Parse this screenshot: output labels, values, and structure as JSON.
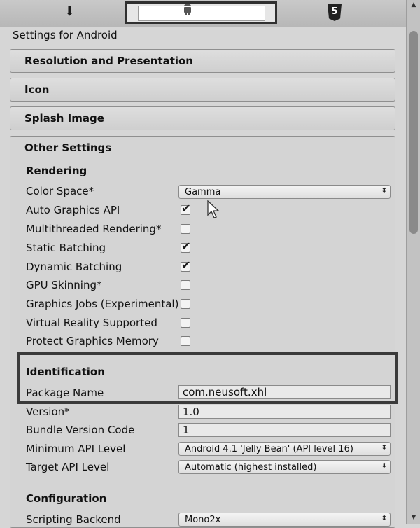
{
  "tabs": [
    {
      "name": "standalone",
      "icon": "download-arrow-icon",
      "selected": false
    },
    {
      "name": "android",
      "icon": "android-icon",
      "selected": true
    },
    {
      "name": "webgl",
      "icon": "html5-icon",
      "label": "5",
      "selected": false
    }
  ],
  "header": {
    "title": "Settings for Android"
  },
  "sections": {
    "resolution": "Resolution and Presentation",
    "icon": "Icon",
    "splash": "Splash Image",
    "other": "Other Settings"
  },
  "rendering": {
    "heading": "Rendering",
    "color_space": {
      "label": "Color Space*",
      "value": "Gamma"
    },
    "auto_graphics": {
      "label": "Auto Graphics API",
      "checked": true
    },
    "multithreaded": {
      "label": "Multithreaded Rendering*",
      "checked": false
    },
    "static_batching": {
      "label": "Static Batching",
      "checked": true
    },
    "dynamic_batching": {
      "label": "Dynamic Batching",
      "checked": true
    },
    "gpu_skinning": {
      "label": "GPU Skinning*",
      "checked": false
    },
    "graphics_jobs": {
      "label": "Graphics Jobs (Experimental)*",
      "checked": false
    },
    "vr_supported": {
      "label": "Virtual Reality Supported",
      "checked": false
    },
    "protect_memory": {
      "label": "Protect Graphics Memory",
      "checked": false
    }
  },
  "identification": {
    "heading": "Identification",
    "package_name": {
      "label": "Package Name",
      "value": "com.neusoft.xhl"
    },
    "version": {
      "label": "Version*",
      "value": "1.0"
    },
    "bundle_version_code": {
      "label": "Bundle Version Code",
      "value": "1"
    },
    "min_api": {
      "label": "Minimum API Level",
      "value": "Android 4.1 'Jelly Bean' (API level 16)"
    },
    "target_api": {
      "label": "Target API Level",
      "value": "Automatic (highest installed)"
    }
  },
  "configuration": {
    "heading": "Configuration",
    "scripting_backend": {
      "label": "Scripting Backend",
      "value": "Mono2x"
    }
  },
  "glyphs": {
    "tick": "✔",
    "dropdown_arrow": "⬍",
    "download": "⬇",
    "scroll_up": "▲",
    "scroll_down": "▼"
  }
}
